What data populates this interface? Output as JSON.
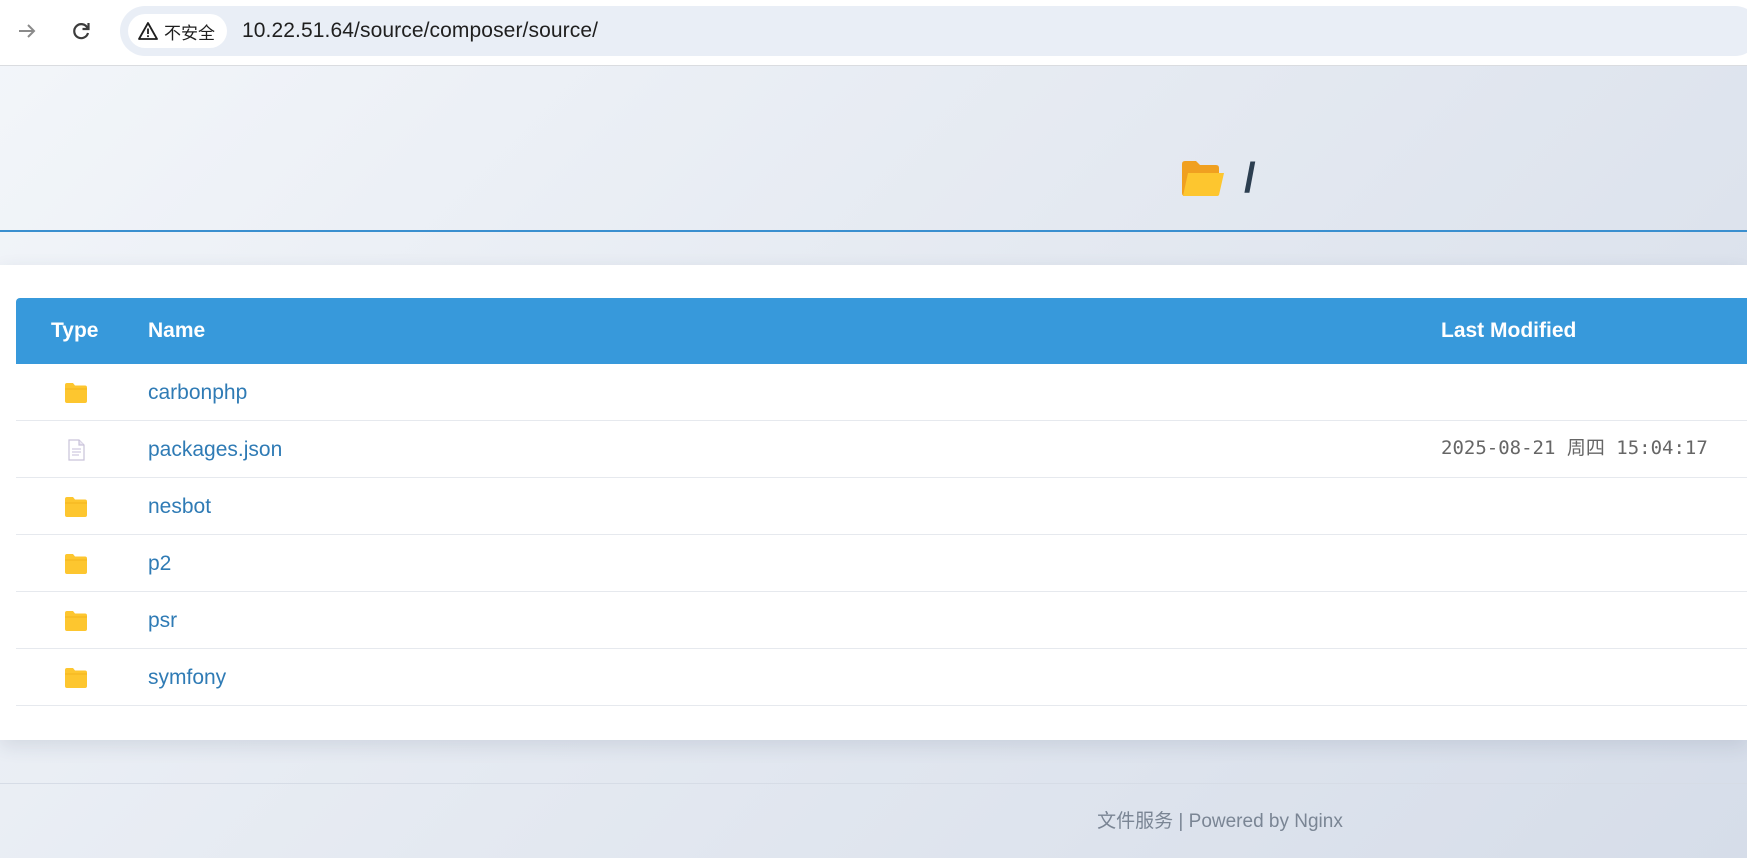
{
  "browser": {
    "security_label": "不安全",
    "url": "10.22.51.64/source/composer/source/"
  },
  "page": {
    "title": "/"
  },
  "table": {
    "headers": {
      "type": "Type",
      "name": "Name",
      "last_modified": "Last Modified"
    },
    "rows": [
      {
        "type": "folder",
        "name": "carbonphp",
        "last_modified": ""
      },
      {
        "type": "file",
        "name": "packages.json",
        "last_modified": "2025-08-21 周四 15:04:17"
      },
      {
        "type": "folder",
        "name": "nesbot",
        "last_modified": ""
      },
      {
        "type": "folder",
        "name": "p2",
        "last_modified": ""
      },
      {
        "type": "folder",
        "name": "psr",
        "last_modified": ""
      },
      {
        "type": "folder",
        "name": "symfony",
        "last_modified": ""
      }
    ]
  },
  "footer": {
    "text": "文件服务 | Powered by Nginx"
  },
  "colors": {
    "header_bg": "#3799db",
    "link": "#2f7bb5",
    "folder": "#fdc62f",
    "accent_line": "#3a8fcf"
  }
}
